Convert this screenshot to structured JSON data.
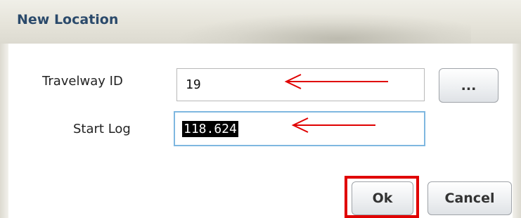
{
  "dialog": {
    "title": "New Location"
  },
  "fields": {
    "travelway": {
      "label": "Travelway ID",
      "value": "19",
      "browse_label": "..."
    },
    "start_log": {
      "label": "Start Log",
      "value": "118.624"
    }
  },
  "buttons": {
    "ok_label": "Ok",
    "cancel_label": "Cancel"
  },
  "annotations": {
    "color": "#e00000"
  }
}
